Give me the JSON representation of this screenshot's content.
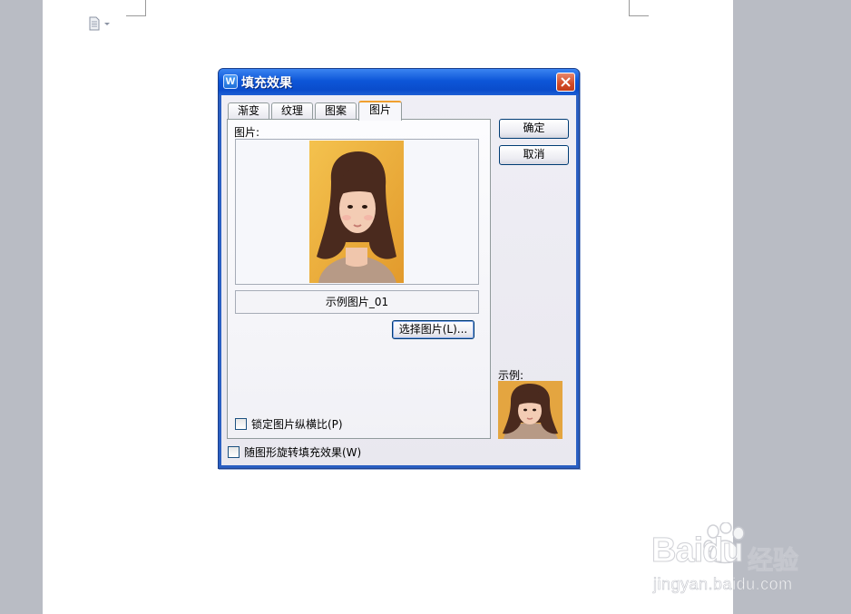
{
  "dialog": {
    "title": "填充效果",
    "tabs": [
      {
        "label": "渐变"
      },
      {
        "label": "纹理"
      },
      {
        "label": "图案"
      },
      {
        "label": "图片",
        "active": true
      }
    ],
    "picture_label": "图片:",
    "picture_name": "示例图片_01",
    "select_button": "选择图片(L)...",
    "lock_aspect_label": "锁定图片纵横比(P)",
    "rotate_with_shape_label": "随图形旋转填充效果(W)",
    "ok_button": "确定",
    "cancel_button": "取消",
    "sample_label": "示例:"
  },
  "watermark": {
    "logo": "Baidu",
    "product": "经验",
    "url": "jingyan.baidu.com"
  },
  "colors": {
    "title_bar": "#0a4ccb",
    "close_button": "#d24b27",
    "active_tab_accent": "#f0a030",
    "photo_background": "#f0b43a",
    "workspace": "#b9bcc4"
  }
}
